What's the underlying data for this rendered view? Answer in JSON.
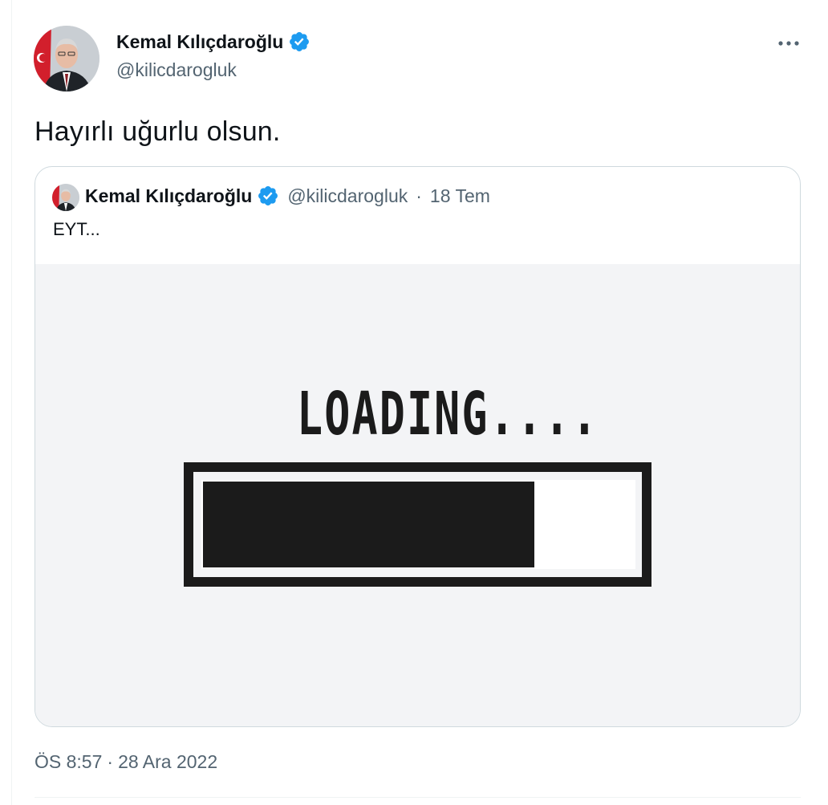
{
  "tweet": {
    "author": {
      "display_name": "Kemal Kılıçdaroğlu",
      "handle": "@kilicdarogluk",
      "verified": true,
      "avatar": "profile-photo"
    },
    "text": "Hayırlı uğurlu olsun.",
    "timestamp": "ÖS 8:57",
    "separator": "·",
    "date": "28 Ara 2022",
    "more_icon": "more-horizontal-icon"
  },
  "quoted_tweet": {
    "author": {
      "display_name": "Kemal Kılıçdaroğlu",
      "handle": "@kilicdarogluk",
      "verified": true
    },
    "separator": "·",
    "date": "18 Tem",
    "text": "EYT...",
    "media": {
      "loading_text": "LOADING....",
      "progress_fraction": 0.77
    }
  },
  "colors": {
    "verified_blue": "#1d9bf0",
    "secondary_text": "#536471",
    "primary_text": "#0f1419",
    "border": "#cfd9de",
    "media_bg": "#f3f4f6",
    "bar_fill": "#1b1b1b"
  }
}
